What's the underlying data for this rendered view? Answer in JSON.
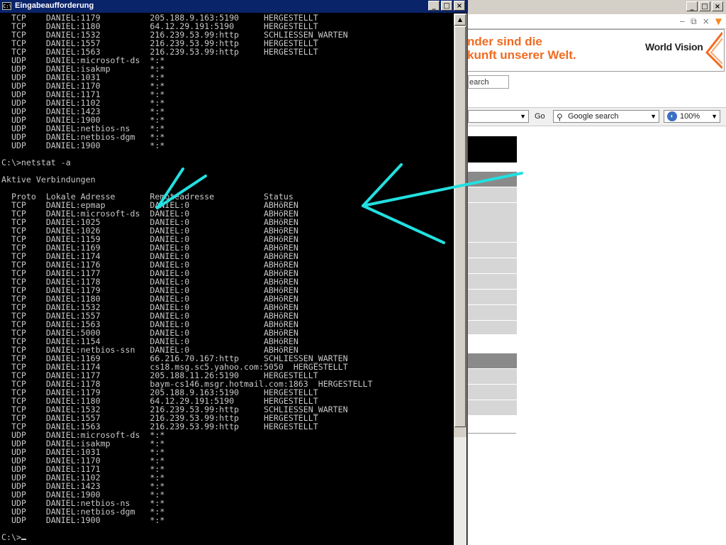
{
  "console": {
    "title": "Eingabeaufforderung",
    "icon_label": "C:\\",
    "buttons": {
      "minimize": "_",
      "maximize": "□",
      "close": "×"
    },
    "lines": [
      "  TCP    DANIEL:1179          205.188.9.163:5190     HERGESTELLT",
      "  TCP    DANIEL:1180          64.12.29.191:5190      HERGESTELLT",
      "  TCP    DANIEL:1532          216.239.53.99:http     SCHLIESSEN_WARTEN",
      "  TCP    DANIEL:1557          216.239.53.99:http     HERGESTELLT",
      "  TCP    DANIEL:1563          216.239.53.99:http     HERGESTELLT",
      "  UDP    DANIEL:microsoft-ds  *:*",
      "  UDP    DANIEL:isakmp        *:*",
      "  UDP    DANIEL:1031          *:*",
      "  UDP    DANIEL:1170          *:*",
      "  UDP    DANIEL:1171          *:*",
      "  UDP    DANIEL:1102          *:*",
      "  UDP    DANIEL:1423          *:*",
      "  UDP    DANIEL:1900          *:*",
      "  UDP    DANIEL:netbios-ns    *:*",
      "  UDP    DANIEL:netbios-dgm   *:*",
      "  UDP    DANIEL:1900          *:*",
      "",
      "C:\\>netstat -a",
      "",
      "Aktive Verbindungen",
      "",
      "  Proto  Lokale Adresse       Remoteadresse          Status",
      "  TCP    DANIEL:epmap         DANIEL:0               ABHöREN",
      "  TCP    DANIEL:microsoft-ds  DANIEL:0               ABHöREN",
      "  TCP    DANIEL:1025          DANIEL:0               ABHöREN",
      "  TCP    DANIEL:1026          DANIEL:0               ABHöREN",
      "  TCP    DANIEL:1159          DANIEL:0               ABHöREN",
      "  TCP    DANIEL:1169          DANIEL:0               ABHöREN",
      "  TCP    DANIEL:1174          DANIEL:0               ABHöREN",
      "  TCP    DANIEL:1176          DANIEL:0               ABHöREN",
      "  TCP    DANIEL:1177          DANIEL:0               ABHöREN",
      "  TCP    DANIEL:1178          DANIEL:0               ABHöREN",
      "  TCP    DANIEL:1179          DANIEL:0               ABHöREN",
      "  TCP    DANIEL:1180          DANIEL:0               ABHöREN",
      "  TCP    DANIEL:1532          DANIEL:0               ABHöREN",
      "  TCP    DANIEL:1557          DANIEL:0               ABHöREN",
      "  TCP    DANIEL:1563          DANIEL:0               ABHöREN",
      "  TCP    DANIEL:5000          DANIEL:0               ABHöREN",
      "  TCP    DANIEL:1154          DANIEL:0               ABHöREN",
      "  TCP    DANIEL:netbios-ssn   DANIEL:0               ABHöREN",
      "  TCP    DANIEL:1169          66.216.70.167:http     SCHLIESSEN_WARTEN",
      "  TCP    DANIEL:1174          cs18.msg.sc5.yahoo.com:5050  HERGESTELLT",
      "  TCP    DANIEL:1177          205.188.11.26:5190     HERGESTELLT",
      "  TCP    DANIEL:1178          baym-cs146.msgr.hotmail.com:1863  HERGESTELLT",
      "  TCP    DANIEL:1179          205.188.9.163:5190     HERGESTELLT",
      "  TCP    DANIEL:1180          64.12.29.191:5190      HERGESTELLT",
      "  TCP    DANIEL:1532          216.239.53.99:http     SCHLIESSEN_WARTEN",
      "  TCP    DANIEL:1557          216.239.53.99:http     HERGESTELLT",
      "  TCP    DANIEL:1563          216.239.53.99:http     HERGESTELLT",
      "  UDP    DANIEL:microsoft-ds  *:*",
      "  UDP    DANIEL:isakmp        *:*",
      "  UDP    DANIEL:1031          *:*",
      "  UDP    DANIEL:1170          *:*",
      "  UDP    DANIEL:1171          *:*",
      "  UDP    DANIEL:1102          *:*",
      "  UDP    DANIEL:1423          *:*",
      "  UDP    DANIEL:1900          *:*",
      "  UDP    DANIEL:netbios-ns    *:*",
      "  UDP    DANIEL:netbios-dgm   *:*",
      "  UDP    DANIEL:1900          *:*",
      ""
    ],
    "prompt": "C:\\>"
  },
  "browser": {
    "banner_line1": "nder sind die",
    "banner_line2": "kunft unserer Welt.",
    "banner_logo": "World Vision",
    "search_button": "earch",
    "go_label": "Go",
    "google_search": "Google search",
    "zoom_value": "100%"
  },
  "colors": {
    "console_bg": "#000000",
    "console_text": "#c8c8c8",
    "titlebar": "#0a246a",
    "banner_orange": "#f26a21",
    "annotation_cyan": "#22e0e0"
  }
}
